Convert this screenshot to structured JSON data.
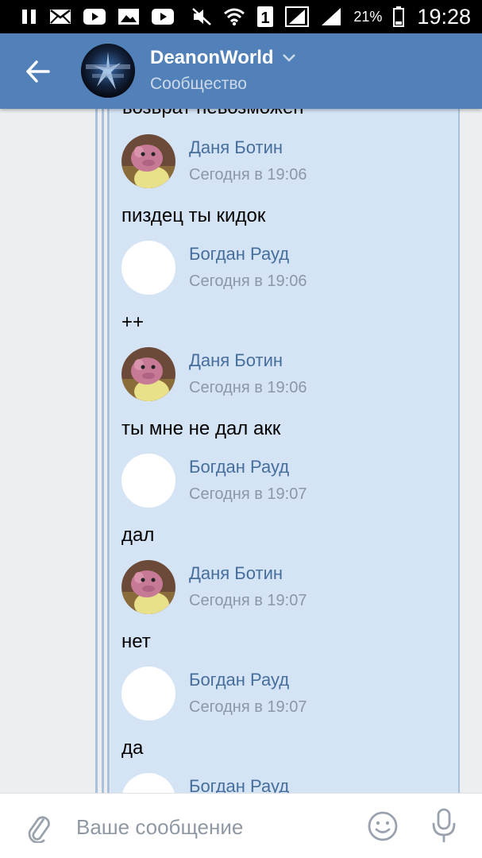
{
  "status_bar": {
    "battery_percent": "21%",
    "time": "19:28",
    "sim_slot": "1",
    "icons": [
      "pause-icon",
      "mail-icon",
      "youtube-icon",
      "gallery-icon",
      "youtube-icon",
      "mute-icon",
      "wifi-icon",
      "sim-icon",
      "signal-icon",
      "signal-icon",
      "battery-icon"
    ]
  },
  "header": {
    "title": "DeanonWorld",
    "subtitle": "Сообщество",
    "accent_color": "#5181b8"
  },
  "thread": {
    "cut_text": "возврат невозможен",
    "comments": [
      {
        "author": "Даня Ботин",
        "time": "Сегодня в 19:06",
        "text": "пиздец ты кидок",
        "avatar": "pink-figure"
      },
      {
        "author": "Богдан Рауд",
        "time": "Сегодня в 19:06",
        "text": "++",
        "avatar": "blank"
      },
      {
        "author": "Даня Ботин",
        "time": "Сегодня в 19:06",
        "text": "ты мне не дал акк",
        "avatar": "pink-figure"
      },
      {
        "author": "Богдан Рауд",
        "time": "Сегодня в 19:07",
        "text": "дал",
        "avatar": "blank"
      },
      {
        "author": "Даня Ботин",
        "time": "Сегодня в 19:07",
        "text": "нет",
        "avatar": "pink-figure"
      },
      {
        "author": "Богдан Рауд",
        "time": "Сегодня в 19:07",
        "text": "да",
        "avatar": "blank"
      },
      {
        "author": "Богдан Рауд",
        "time": "",
        "text": "",
        "avatar": "blank"
      }
    ]
  },
  "compose": {
    "placeholder": "Ваше сообщение"
  }
}
